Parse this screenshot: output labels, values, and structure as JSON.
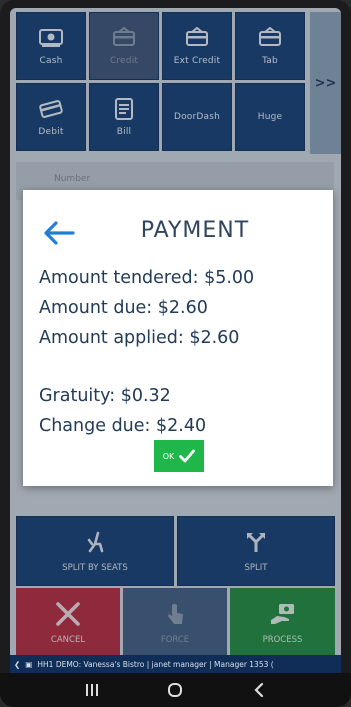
{
  "tenders": [
    {
      "label": "Cash",
      "icon": "cash-icon",
      "enabled": true
    },
    {
      "label": "Credit",
      "icon": "credit-card-icon",
      "enabled": false
    },
    {
      "label": "Ext Credit",
      "icon": "credit-card-icon",
      "enabled": true
    },
    {
      "label": "Tab",
      "icon": "credit-card-icon",
      "enabled": true
    },
    {
      "label": "Debit",
      "icon": "debit-card-icon",
      "enabled": true
    },
    {
      "label": "Bill",
      "icon": "bill-icon",
      "enabled": true
    },
    {
      "label": "DoorDash",
      "icon": "",
      "enabled": true
    },
    {
      "label": "Huge",
      "icon": "",
      "enabled": true
    }
  ],
  "more_label": ">>",
  "number_label": "Number",
  "modal": {
    "title": "PAYMENT",
    "lines": [
      "Amount tendered: $5.00",
      "Amount due: $2.60",
      "Amount applied: $2.60",
      "Gratuity: $0.32",
      "Change due: $2.40"
    ],
    "ok_label": "OK"
  },
  "split": {
    "by_seats_label": "SPLIT BY SEATS",
    "split_label": "SPLIT"
  },
  "actions": {
    "cancel_label": "CANCEL",
    "force_label": "FORCE",
    "process_label": "PROCESS"
  },
  "status_text": "HH1  DEMO: Vanessa's Bistro | janet manager | Manager 1353 (",
  "colors": {
    "tender_blue": "#123c73",
    "cancel_red": "#b8283c",
    "process_green": "#1e8a3c",
    "ok_green": "#1fb64a",
    "back_arrow_blue": "#1f7fd6"
  }
}
